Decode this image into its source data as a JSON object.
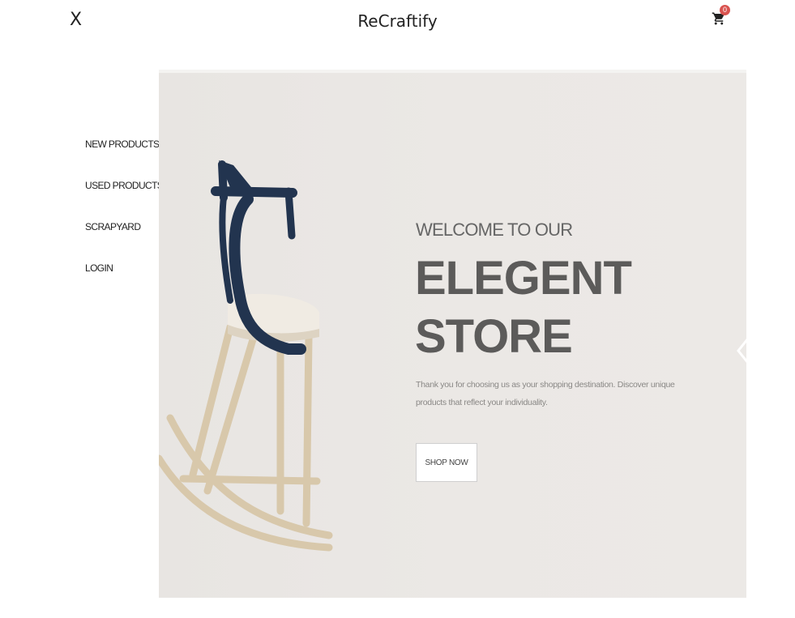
{
  "header": {
    "close_label": "X",
    "brand": "ReCraftify",
    "cart_count": "0"
  },
  "sidebar": {
    "items": [
      {
        "label": "NEW PRODUCTS"
      },
      {
        "label": "USED PRODUCTS"
      },
      {
        "label": "SCRAPYARD"
      },
      {
        "label": "LOGIN"
      }
    ]
  },
  "hero": {
    "welcome": "WELCOME TO OUR",
    "headline_line1": "ELEGENT",
    "headline_line2": "STORE",
    "tagline": "Thank you for choosing us as your shopping destination. Discover unique products that reflect your individuality.",
    "cta_label": "SHOP NOW"
  },
  "colors": {
    "hero_bg": "#eae7e4",
    "chair_blue": "#22344f",
    "chair_wood": "#d9c9ad",
    "badge_red": "#d9534f"
  },
  "icons": {
    "close": "close-icon",
    "cart": "cart-icon",
    "next": "chevron-right-icon"
  }
}
